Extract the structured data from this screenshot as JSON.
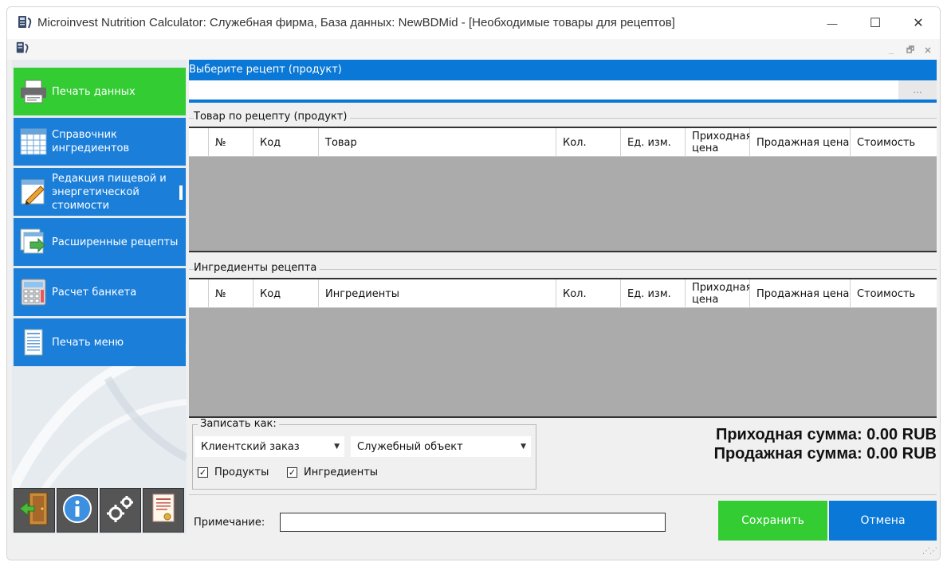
{
  "window": {
    "title": "Microinvest Nutrition Calculator: Служебная фирма, База данных: NewBDMid - [Необходимые товары для рецептов]",
    "minimize_glyph": "—",
    "maximize_glyph": "☐",
    "close_glyph": "✕"
  },
  "mdi": {
    "minimize_glyph": "_",
    "restore_glyph": "🗗",
    "close_glyph": "✕"
  },
  "sidebar": {
    "items": [
      {
        "label": "Печать данных",
        "icon": "printer-icon"
      },
      {
        "label": "Справочник ингредиентов",
        "icon": "table-icon"
      },
      {
        "label": "Редакция пищевой и энергетической стоимости",
        "icon": "edit-pencil-icon"
      },
      {
        "label": "Расширенные рецепты",
        "icon": "recipe-pages-icon"
      },
      {
        "label": "Расчет банкета",
        "icon": "calculator-icon"
      },
      {
        "label": "Печать меню",
        "icon": "menu-document-icon"
      }
    ],
    "bottom_icons": [
      "exit-door-icon",
      "info-icon",
      "settings-gears-icon",
      "certificate-icon"
    ]
  },
  "recipe": {
    "label": "Выберите рецепт (продукт)",
    "value": "",
    "browse_label": "..."
  },
  "products_group": {
    "title": "Товар по рецепту (продукт)",
    "columns": [
      "№",
      "Код",
      "Товар",
      "Кол.",
      "Ед. изм.",
      "Приходная цена",
      "Продажная цена",
      "Стоимость"
    ],
    "rows": []
  },
  "ingredients_group": {
    "title": "Ингредиенты рецепта",
    "columns": [
      "№",
      "Код",
      "Ингредиенты",
      "Кол.",
      "Ед. изм.",
      "Приходная цена",
      "Продажная цена",
      "Стоимость"
    ],
    "rows": []
  },
  "save_as": {
    "legend": "Записать как:",
    "type_value": "Клиентский заказ",
    "object_value": "Служебный объект",
    "products_label": "Продукты",
    "products_checked": true,
    "ingredients_label": "Ингредиенты",
    "ingredients_checked": true
  },
  "totals": {
    "purchase_label": "Приходная сумма: 0.00 RUB",
    "sale_label": "Продажная сумма: 0.00 RUB"
  },
  "note": {
    "label": "Примечание:",
    "value": ""
  },
  "buttons": {
    "save": "Сохранить",
    "cancel": "Отмена"
  },
  "colors": {
    "accent_blue": "#0a78d7",
    "accent_green": "#33cc33",
    "grid_body": "#ababab"
  }
}
